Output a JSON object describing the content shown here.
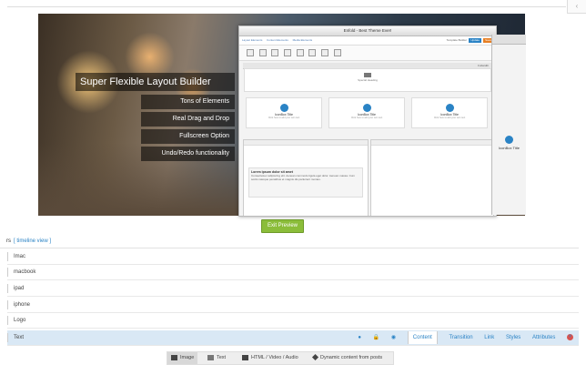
{
  "preview": {
    "headline": "Super Flexible Layout Builder",
    "features": [
      "Tons of Elements",
      "Real Drag and Drop",
      "Fullscreen Option",
      "Undo/Redo functionality"
    ],
    "builder_window_title": "Enfold - Best Theme Ever!",
    "builder_menu": [
      "Layout Elements",
      "Content Elements",
      "Media Elements"
    ],
    "builder_menu_right": [
      "Template Builder",
      "Update",
      "Save"
    ],
    "builder_bar_label": "Fullwidth",
    "builder_iconbox_title": "IconBox Title",
    "builder_iconbox_sub": "Click here to add your own text",
    "builder_text_heading": "Lorem ipsum dolor sit amet",
    "builder_text_body": "Consectetuer adipiscing elit. Aenean commodo ligula eget dolor. Aenean massa. Cum sociis natoque penatibus et magnis dis parturient montes.",
    "builder_special_heading": "Special Heading",
    "right_partial_title": "IconBox Title"
  },
  "exit_preview_label": "Exit Preview",
  "layers_header": {
    "prefix": "rs",
    "timeline_link": "[ timeline view ]"
  },
  "layers": [
    {
      "label": "Imac"
    },
    {
      "label": "macbook"
    },
    {
      "label": "ipad"
    },
    {
      "label": "iphone"
    },
    {
      "label": "Logo"
    },
    {
      "label": "Text"
    }
  ],
  "selected_layer_tabs": [
    "Content",
    "Transition",
    "Link",
    "Styles",
    "Attributes"
  ],
  "add_bar": [
    {
      "label": "Image",
      "icon": "image-icon"
    },
    {
      "label": "Text",
      "icon": "text-icon"
    },
    {
      "label": "HTML / Video / Audio",
      "icon": "video-icon"
    },
    {
      "label": "Dynamic content from posts",
      "icon": "pin-icon"
    }
  ],
  "colors": {
    "accent": "#2a83c5",
    "exit_button": "#8bbd3a",
    "selected_row": "#d9e8f5",
    "delete": "#d9534f"
  }
}
